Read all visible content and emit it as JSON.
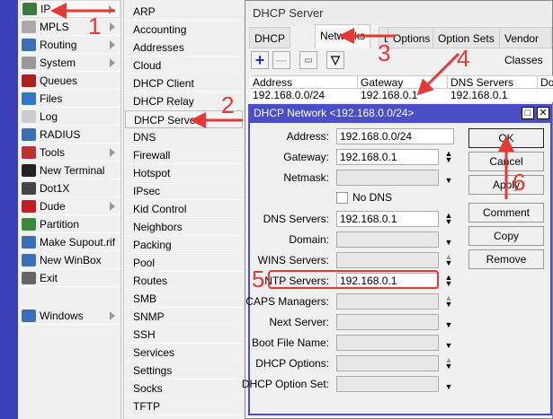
{
  "menu": {
    "items": [
      {
        "label": "IP",
        "icon": "ip-icon",
        "color": "#3a7a3a",
        "sub": true
      },
      {
        "label": "MPLS",
        "icon": "mpls-icon",
        "color": "#aaaaaa",
        "sub": true
      },
      {
        "label": "Routing",
        "icon": "routing-icon",
        "color": "#3b6fb5",
        "sub": true
      },
      {
        "label": "System",
        "icon": "system-icon",
        "color": "#999999",
        "sub": true
      },
      {
        "label": "Queues",
        "icon": "queues-icon",
        "color": "#b02020",
        "sub": false
      },
      {
        "label": "Files",
        "icon": "files-icon",
        "color": "#2f78c4",
        "sub": false
      },
      {
        "label": "Log",
        "icon": "log-icon",
        "color": "#cccccc",
        "sub": false
      },
      {
        "label": "RADIUS",
        "icon": "radius-icon",
        "color": "#3b6fb5",
        "sub": false
      },
      {
        "label": "Tools",
        "icon": "tools-icon",
        "color": "#c03030",
        "sub": true
      },
      {
        "label": "New Terminal",
        "icon": "terminal-icon",
        "color": "#222222",
        "sub": false
      },
      {
        "label": "Dot1X",
        "icon": "dot1x-icon",
        "color": "#444444",
        "sub": false
      },
      {
        "label": "Dude",
        "icon": "dude-icon",
        "color": "#c02020",
        "sub": true
      },
      {
        "label": "Partition",
        "icon": "partition-icon",
        "color": "#3a8a3a",
        "sub": false
      },
      {
        "label": "Make Supout.rif",
        "icon": "supout-icon",
        "color": "#3b6fb5",
        "sub": false
      },
      {
        "label": "New WinBox",
        "icon": "winbox-icon",
        "color": "#3b6fb5",
        "sub": false
      },
      {
        "label": "Exit",
        "icon": "exit-icon",
        "color": "#666666",
        "sub": false
      },
      {
        "label": "Windows",
        "icon": "windows-icon",
        "color": "#3b6fb5",
        "sub": true
      }
    ]
  },
  "submenu": {
    "items": [
      "ARP",
      "Accounting",
      "Addresses",
      "Cloud",
      "DHCP Client",
      "DHCP Relay",
      "DHCP Server",
      "DNS",
      "Firewall",
      "Hotspot",
      "IPsec",
      "Kid Control",
      "Neighbors",
      "Packing",
      "Pool",
      "Routes",
      "SMB",
      "SNMP",
      "SSH",
      "Services",
      "Settings",
      "Socks",
      "TFTP"
    ]
  },
  "window": {
    "title": "DHCP Server",
    "tabs": [
      "DHCP",
      "Networks",
      "Leases",
      "Options",
      "Option Sets",
      "Vendor Classes"
    ],
    "columns": [
      "Address",
      "Gateway",
      "DNS Servers",
      "Domain"
    ],
    "row": [
      "192.168.0.0/24",
      "192.168.0.1",
      "192.168.0.1",
      ""
    ]
  },
  "dialog": {
    "title": "DHCP Network <192.168.0.0/24>",
    "fields": [
      {
        "label": "Address:",
        "value": "192.168.0.0/24",
        "ctrl": "none"
      },
      {
        "label": "Gateway:",
        "value": "192.168.0.1",
        "ctrl": "updown"
      },
      {
        "label": "Netmask:",
        "value": "",
        "ctrl": "down"
      },
      {
        "label": "",
        "value": "",
        "ctrl": "check",
        "check_label": "No DNS"
      },
      {
        "label": "DNS Servers:",
        "value": "192.168.0.1",
        "ctrl": "updown"
      },
      {
        "label": "Domain:",
        "value": "",
        "ctrl": "down"
      },
      {
        "label": "WINS Servers:",
        "value": "",
        "ctrl": "updown-dim"
      },
      {
        "label": "NTP Servers:",
        "value": "192.168.0.1",
        "ctrl": "updown"
      },
      {
        "label": "CAPS Managers:",
        "value": "",
        "ctrl": "updown-dim"
      },
      {
        "label": "Next Server:",
        "value": "",
        "ctrl": "down"
      },
      {
        "label": "Boot File Name:",
        "value": "",
        "ctrl": "down"
      },
      {
        "label": "DHCP Options:",
        "value": "",
        "ctrl": "updown-dim"
      },
      {
        "label": "DHCP Option Set:",
        "value": "",
        "ctrl": "down"
      }
    ],
    "buttons": [
      "OK",
      "Cancel",
      "Apply",
      "Comment",
      "Copy",
      "Remove"
    ]
  },
  "annotations": [
    "1",
    "2",
    "3",
    "4",
    "5",
    "6"
  ],
  "colors": {
    "annotation": "#e53935",
    "title_bar": "#4b4fc6"
  }
}
